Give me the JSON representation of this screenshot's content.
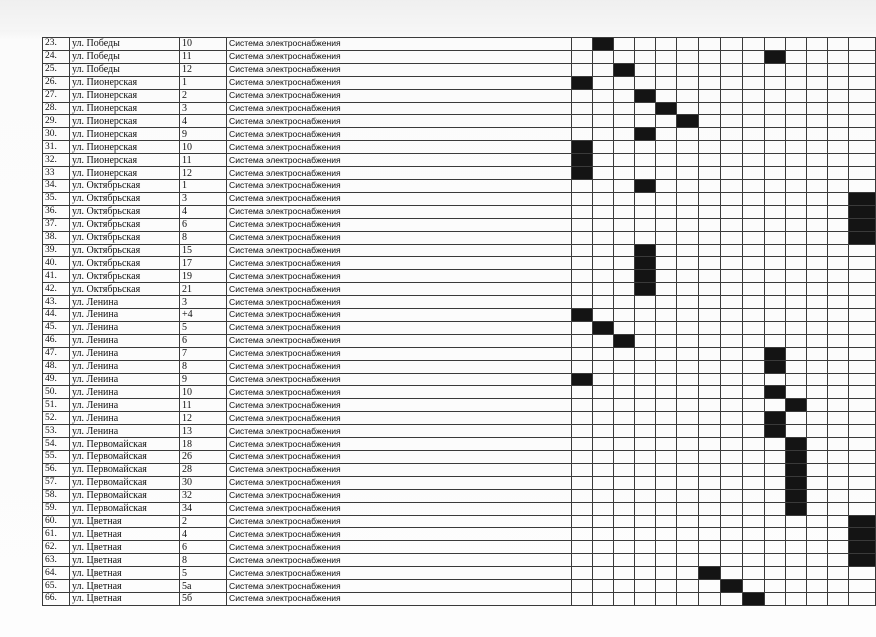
{
  "document": {
    "system_label": "Система электроснабжения",
    "month_columns": 14
  },
  "rows": [
    {
      "num": "23.",
      "street": "ул. Победы",
      "house": "10",
      "marks": [
        1
      ]
    },
    {
      "num": "24.",
      "street": "ул. Победы",
      "house": "11",
      "marks": [
        9
      ]
    },
    {
      "num": "25.",
      "street": "ул. Победы",
      "house": "12",
      "marks": [
        2
      ]
    },
    {
      "num": "26.",
      "street": "ул. Пионерская",
      "house": "1",
      "marks": [
        0
      ]
    },
    {
      "num": "27.",
      "street": "ул. Пионерская",
      "house": "2",
      "marks": [
        3
      ]
    },
    {
      "num": "28.",
      "street": "ул. Пионерская",
      "house": "3",
      "marks": [
        4
      ]
    },
    {
      "num": "29.",
      "street": "ул. Пионерская",
      "house": "4",
      "marks": [
        5
      ]
    },
    {
      "num": "30.",
      "street": "ул. Пионерская",
      "house": "9",
      "marks": [
        3
      ]
    },
    {
      "num": "31.",
      "street": "ул. Пионерская",
      "house": "10",
      "marks": [
        0
      ]
    },
    {
      "num": "32.",
      "street": "ул. Пионерская",
      "house": "11",
      "marks": [
        0
      ]
    },
    {
      "num": "33",
      "street": "ул. Пионерская",
      "house": "12",
      "marks": [
        0
      ]
    },
    {
      "num": "34.",
      "street": "ул. Октябрьская",
      "house": "1",
      "marks": [
        3
      ]
    },
    {
      "num": "35.",
      "street": "ул. Октябрьская",
      "house": "3",
      "marks": [
        13
      ]
    },
    {
      "num": "36.",
      "street": "ул. Октябрьская",
      "house": "4",
      "marks": [
        13
      ]
    },
    {
      "num": "37.",
      "street": "ул. Октябрьская",
      "house": "6",
      "marks": [
        13
      ]
    },
    {
      "num": "38.",
      "street": "ул. Октябрьская",
      "house": "8",
      "marks": [
        13
      ]
    },
    {
      "num": "39.",
      "street": "ул. Октябрьская",
      "house": "15",
      "marks": [
        3
      ]
    },
    {
      "num": "40.",
      "street": "ул. Октябрьская",
      "house": "17",
      "marks": [
        3
      ]
    },
    {
      "num": "41.",
      "street": "ул. Октябрьская",
      "house": "19",
      "marks": [
        3
      ]
    },
    {
      "num": "42.",
      "street": "ул. Октябрьская",
      "house": "21",
      "marks": [
        3
      ]
    },
    {
      "num": "43.",
      "street": "ул. Ленина",
      "house": "3",
      "marks": []
    },
    {
      "num": "44.",
      "street": "ул. Ленина",
      "house": "+4",
      "marks": [
        0
      ]
    },
    {
      "num": "45.",
      "street": "ул. Ленина",
      "house": "5",
      "marks": [
        1
      ]
    },
    {
      "num": "46.",
      "street": "ул. Ленина",
      "house": "6",
      "marks": [
        2
      ]
    },
    {
      "num": "47.",
      "street": "ул. Ленина",
      "house": "7",
      "marks": [
        9
      ]
    },
    {
      "num": "48.",
      "street": "ул. Ленина",
      "house": "8",
      "marks": [
        9
      ]
    },
    {
      "num": "49.",
      "street": "ул. Ленина",
      "house": "9",
      "marks": [
        0
      ]
    },
    {
      "num": "50.",
      "street": "ул. Ленина",
      "house": "10",
      "marks": [
        9
      ]
    },
    {
      "num": "51.",
      "street": "ул. Ленина",
      "house": "11",
      "marks": [
        10
      ]
    },
    {
      "num": "52.",
      "street": "ул. Ленина",
      "house": "12",
      "marks": [
        9
      ]
    },
    {
      "num": "53.",
      "street": "ул. Ленина",
      "house": "13",
      "marks": [
        9
      ]
    },
    {
      "num": "54.",
      "street": "ул. Первомайская",
      "house": "18",
      "marks": [
        10
      ]
    },
    {
      "num": "55.",
      "street": "ул. Первомайская",
      "house": "26",
      "marks": [
        10
      ]
    },
    {
      "num": "56.",
      "street": "ул. Первомайская",
      "house": "28",
      "marks": [
        10
      ]
    },
    {
      "num": "57.",
      "street": "ул. Первомайская",
      "house": "30",
      "marks": [
        10
      ]
    },
    {
      "num": "58.",
      "street": "ул. Первомайская",
      "house": "32",
      "marks": [
        10
      ]
    },
    {
      "num": "59.",
      "street": "ул. Первомайская",
      "house": "34",
      "marks": [
        10
      ]
    },
    {
      "num": "60.",
      "street": "ул. Цветная",
      "house": "2",
      "marks": [
        13
      ]
    },
    {
      "num": "61.",
      "street": "ул. Цветная",
      "house": "4",
      "marks": [
        13
      ]
    },
    {
      "num": "62.",
      "street": "ул. Цветная",
      "house": "6",
      "marks": [
        13
      ]
    },
    {
      "num": "63.",
      "street": "ул. Цветная",
      "house": "8",
      "marks": [
        13
      ]
    },
    {
      "num": "64.",
      "street": "ул. Цветная",
      "house": "5",
      "marks": [
        6
      ]
    },
    {
      "num": "65.",
      "street": "ул. Цветная",
      "house": "5а",
      "marks": [
        7
      ]
    },
    {
      "num": "66.",
      "street": "ул. Цветная",
      "house": "5б",
      "marks": [
        8
      ]
    }
  ]
}
